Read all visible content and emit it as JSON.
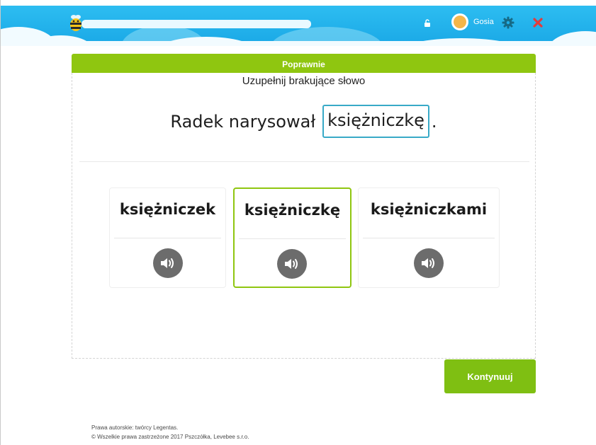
{
  "topbar": {
    "progress_fraction": 1.0,
    "user_name": "Gosia",
    "icons": {
      "logo": "bee-icon",
      "lock": "lock-icon",
      "avatar": "avatar-icon",
      "settings": "gear-icon",
      "close": "close-icon"
    }
  },
  "card": {
    "header": "Poprawnie",
    "instruction": "Uzupełnij brakujące słowo",
    "sentence": {
      "before": "Radek narysował",
      "answer": "księżniczkę",
      "after": "."
    },
    "choices": [
      {
        "label": "księżniczek",
        "selected": false,
        "icon": "speaker-icon"
      },
      {
        "label": "księżniczkę",
        "selected": true,
        "icon": "speaker-icon"
      },
      {
        "label": "księżniczkami",
        "selected": false,
        "icon": "speaker-icon"
      }
    ]
  },
  "continue_label": "Kontynuuj",
  "footer": {
    "line1": "Prawa autorskie: twórcy Legentas.",
    "line2": "© Wszelkie prawa zastrzeżone 2017 Pszczółka, Levebee s.r.o."
  },
  "colors": {
    "sky": "#1fb0ea",
    "accent_green": "#8fc610",
    "answer_border": "#38aac7",
    "close_red": "#e23c3c"
  }
}
